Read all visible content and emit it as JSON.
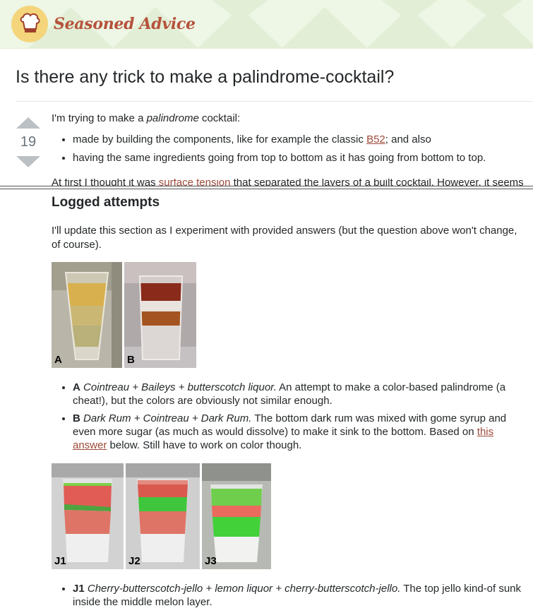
{
  "site": {
    "name": "Seasoned Advice",
    "logo_icon": "chef-hat-icon"
  },
  "question": {
    "title": "Is there any trick to make a palindrome-cocktail?",
    "votes": "19",
    "intro_before": "I'm trying to make a ",
    "intro_em": "palindrome",
    "intro_after": " cocktail:",
    "bullet1_before": "made by building the components, like for example the classic ",
    "bullet1_link": "B52",
    "bullet1_after": "; and also",
    "bullet2": "having the same ingredients going from top to bottom as it has going from bottom to top.",
    "cut_before": "At first I thought it was ",
    "cut_link": "surface tension",
    "cut_after": " that separated the layers of a built cocktail. However, it seems"
  },
  "logged": {
    "heading": "Logged attempts",
    "intro": "I'll update this section as I experiment with provided answers (but the question above won't change, of course).",
    "photos1": [
      "A",
      "B"
    ],
    "attemptA": {
      "label": "A",
      "em": "Cointreau + Baileys + butterscotch liquor.",
      "text": " An attempt to make a color-based palindrome (a cheat!), but the colors are obviously not similar enough."
    },
    "attemptB": {
      "label": "B",
      "em": "Dark Rum + Cointreau + Dark Rum.",
      "text": " The bottom dark rum was mixed with gome syrup and even more sugar (as much as would dissolve) to make it sink to the bottom. Based on ",
      "link": "this answer",
      "after": " below. Still have to work on color though."
    },
    "photos2": [
      "J1",
      "J2",
      "J3"
    ],
    "attemptJ1": {
      "label": "J1",
      "em": "Cherry-butterscotch-jello + lemon liquor + cherry-butterscotch-jello.",
      "text": " The top jello kind-of sunk inside the middle melon layer."
    }
  }
}
